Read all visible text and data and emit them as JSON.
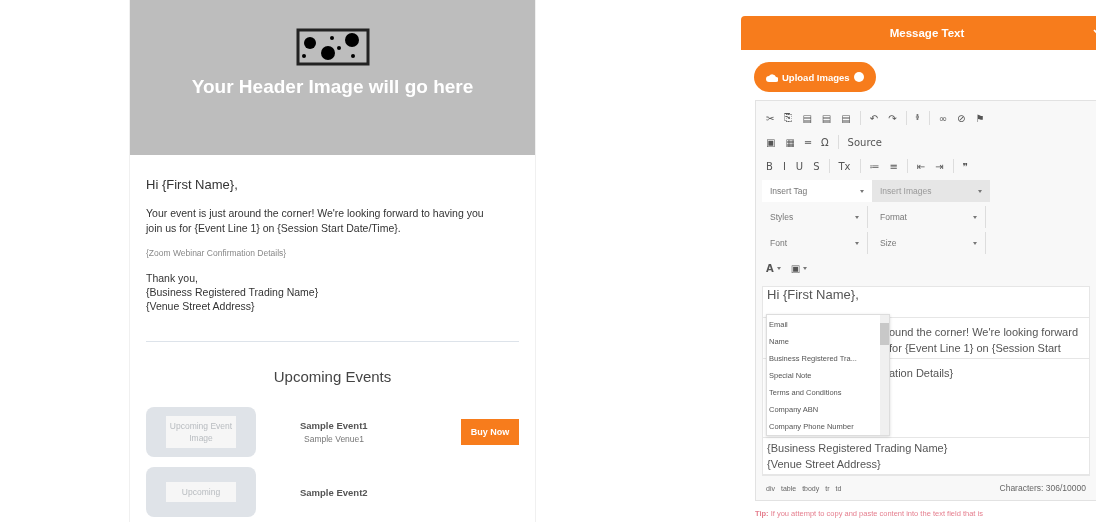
{
  "email": {
    "header_image_text": "Your Header Image will go here",
    "greeting": "Hi {First Name},",
    "body": "Your event is just around the corner! We're looking forward to having you join us for {Event Line 1} on {Session Start Date/Time}.",
    "zoom_details": "{Zoom Webinar Confirmation Details}",
    "signoff": [
      "Thank you,",
      "{Business Registered Trading Name}",
      "{Venue Street Address}"
    ],
    "events_title": "Upcoming Events",
    "events": [
      {
        "image_text": "Upcoming Event Image",
        "name": "Sample Event1",
        "venue": "Sample Venue1",
        "button": "Buy Now"
      },
      {
        "image_text": "Upcoming",
        "name": "Sample Event2"
      }
    ]
  },
  "panel": {
    "title": "Message Text",
    "upload_button": "Upload Images",
    "toolbar_rows": [
      [
        [
          "✂",
          "⎘",
          "▤",
          "▤",
          "▤"
        ],
        [
          "↶",
          "↷"
        ],
        [
          "ᶲ"
        ],
        [
          "∞",
          "⊘",
          "⚑"
        ]
      ],
      [
        [
          "▣",
          "▦",
          "═",
          "Ω"
        ],
        [
          "Source"
        ]
      ],
      [
        [
          "B",
          "I",
          "U",
          "S"
        ],
        [
          "Tx"
        ],
        [
          "≔",
          "≡"
        ],
        [
          "⇤",
          "⇥"
        ],
        [
          "❞"
        ]
      ]
    ],
    "selects": [
      {
        "label": "Insert Tag",
        "disabled": false
      },
      {
        "label": "Insert Images",
        "disabled": true
      },
      {
        "label": "Styles",
        "disabled": false
      },
      {
        "label": "Format",
        "disabled": false
      },
      {
        "label": "Font",
        "disabled": false
      },
      {
        "label": "Size",
        "disabled": false
      }
    ],
    "color_buttons": [
      "A",
      "▣"
    ],
    "content_rows": [
      {
        "lines": [
          "Hi {First Name},"
        ],
        "covered": false,
        "big": true
      },
      {
        "lines": [
          "ound the corner! We're looking forward",
          "for {Event Line 1} on {Session Start"
        ],
        "covered": true,
        "big": false
      },
      {
        "lines": [
          "ation Details}"
        ],
        "covered": true,
        "big": false
      },
      {
        "lines": [
          "{Business Registered Trading Name}",
          "{Venue Street Address}"
        ],
        "covered": false,
        "big": false
      }
    ],
    "tag_menu": [
      "Email",
      "Name",
      "Business Registered Tra...",
      "Special Note",
      "Terms and Conditions",
      "Company ABN",
      "Company Phone Number"
    ],
    "path": [
      "div",
      "table",
      "tbody",
      "tr",
      "td"
    ],
    "char_count": "Characters: 306/10000",
    "tip": "**Tip:** If you attempt to copy and paste content into the text field that is"
  }
}
